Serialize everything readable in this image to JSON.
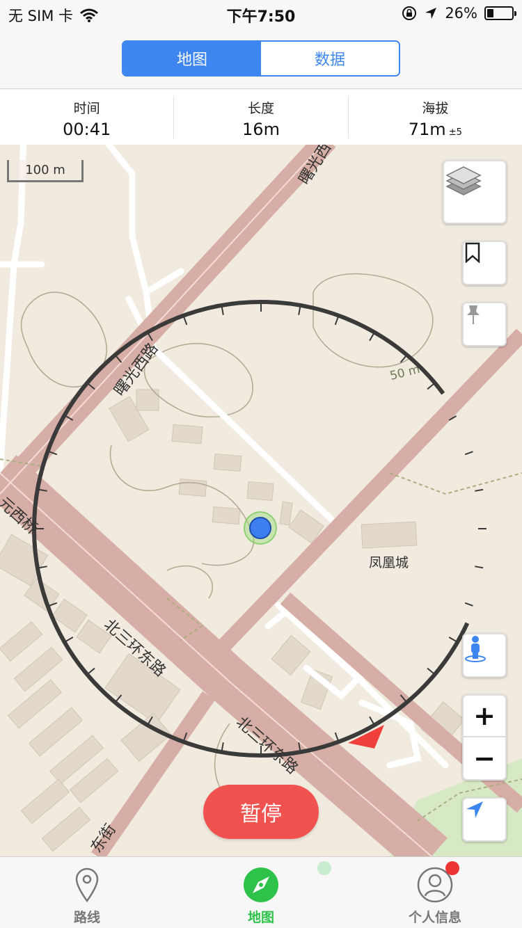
{
  "status_bar": {
    "carrier": "无 SIM 卡",
    "time": "下午7:50",
    "battery": "26%",
    "battery_level": 0.26
  },
  "segment": {
    "map": "地图",
    "data": "数据",
    "active": "map"
  },
  "stats": {
    "time_label": "时间",
    "time_value": "00:41",
    "length_label": "长度",
    "length_value": "16m",
    "altitude_label": "海拔",
    "altitude_value": "71m",
    "altitude_accuracy": "±5"
  },
  "map": {
    "scale": "100 m",
    "labels": {
      "shuguang_top": "曙光西",
      "shuguang": "曙光西路",
      "yuanxi": "元西桥",
      "beisanhuan_1": "北三环东路",
      "beisanhuan_2": "北三环东路",
      "fenghuang": "凤凰城",
      "dongjie": "东街",
      "contour": "50 m"
    }
  },
  "buttons": {
    "pause": "暂停",
    "zoom_in": "+",
    "zoom_out": "−"
  },
  "tabs": [
    {
      "label": "路线",
      "icon": "map-pin-icon"
    },
    {
      "label": "地图",
      "icon": "compass-icon"
    },
    {
      "label": "个人信息",
      "icon": "person-icon"
    }
  ],
  "colors": {
    "accent": "#3d86f0",
    "active_tab": "#2ec24a",
    "pause": "#f0524f",
    "badge": "#ee3333",
    "location": "#3d7ef0"
  }
}
